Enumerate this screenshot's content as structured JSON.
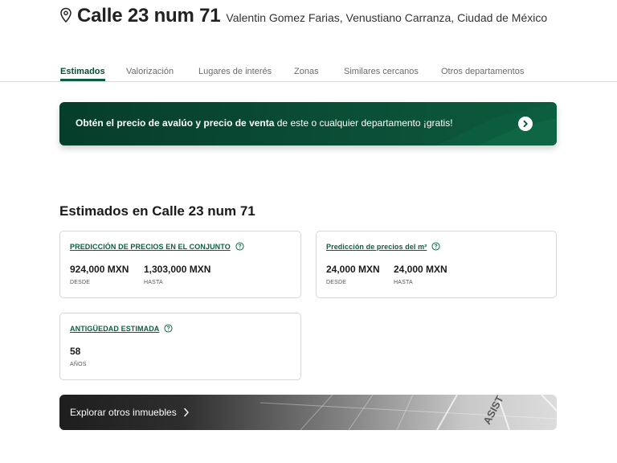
{
  "header": {
    "title": "Calle 23 num 71",
    "address": "Valentin Gomez Farias, Venustiano Carranza, Ciudad de México",
    "icon": "map-pin-icon"
  },
  "tabs": [
    {
      "label": "Estimados",
      "active": true
    },
    {
      "label": "Valorización",
      "active": false
    },
    {
      "label": "Lugares de interés",
      "active": false
    },
    {
      "label": "Zonas",
      "active": false
    },
    {
      "label": "Similares cercanos",
      "active": false
    },
    {
      "label": "Otros departamentos",
      "active": false
    }
  ],
  "banner": {
    "bold_text": "Obtén el precio de avalúo y precio de venta",
    "rest_text": " de este o cualquier departamento ¡gratis!",
    "icon": "chevron-right-circle-icon"
  },
  "section_title": "Estimados en Calle 23 num 71",
  "cards": {
    "conjunto": {
      "label": "Predicción de precios en el conjunto",
      "from_value": "924,000 MXN",
      "from_caption": "Desde",
      "to_value": "1,303,000 MXN",
      "to_caption": "Hasta"
    },
    "m2": {
      "label": "Predicción de precios del m²",
      "from_value": "24,000 MXN",
      "from_caption": "Desde",
      "to_value": "24,000 MXN",
      "to_caption": "Hasta"
    },
    "antiguedad": {
      "label": "Antigüedad estimada",
      "value": "58",
      "caption": "Años"
    }
  },
  "explore": {
    "label": "Explorar otros inmuebles",
    "map_text": "ASIST"
  },
  "colors": {
    "brand_green": "#0b5e3f",
    "banner_dark": "#063d2b"
  }
}
